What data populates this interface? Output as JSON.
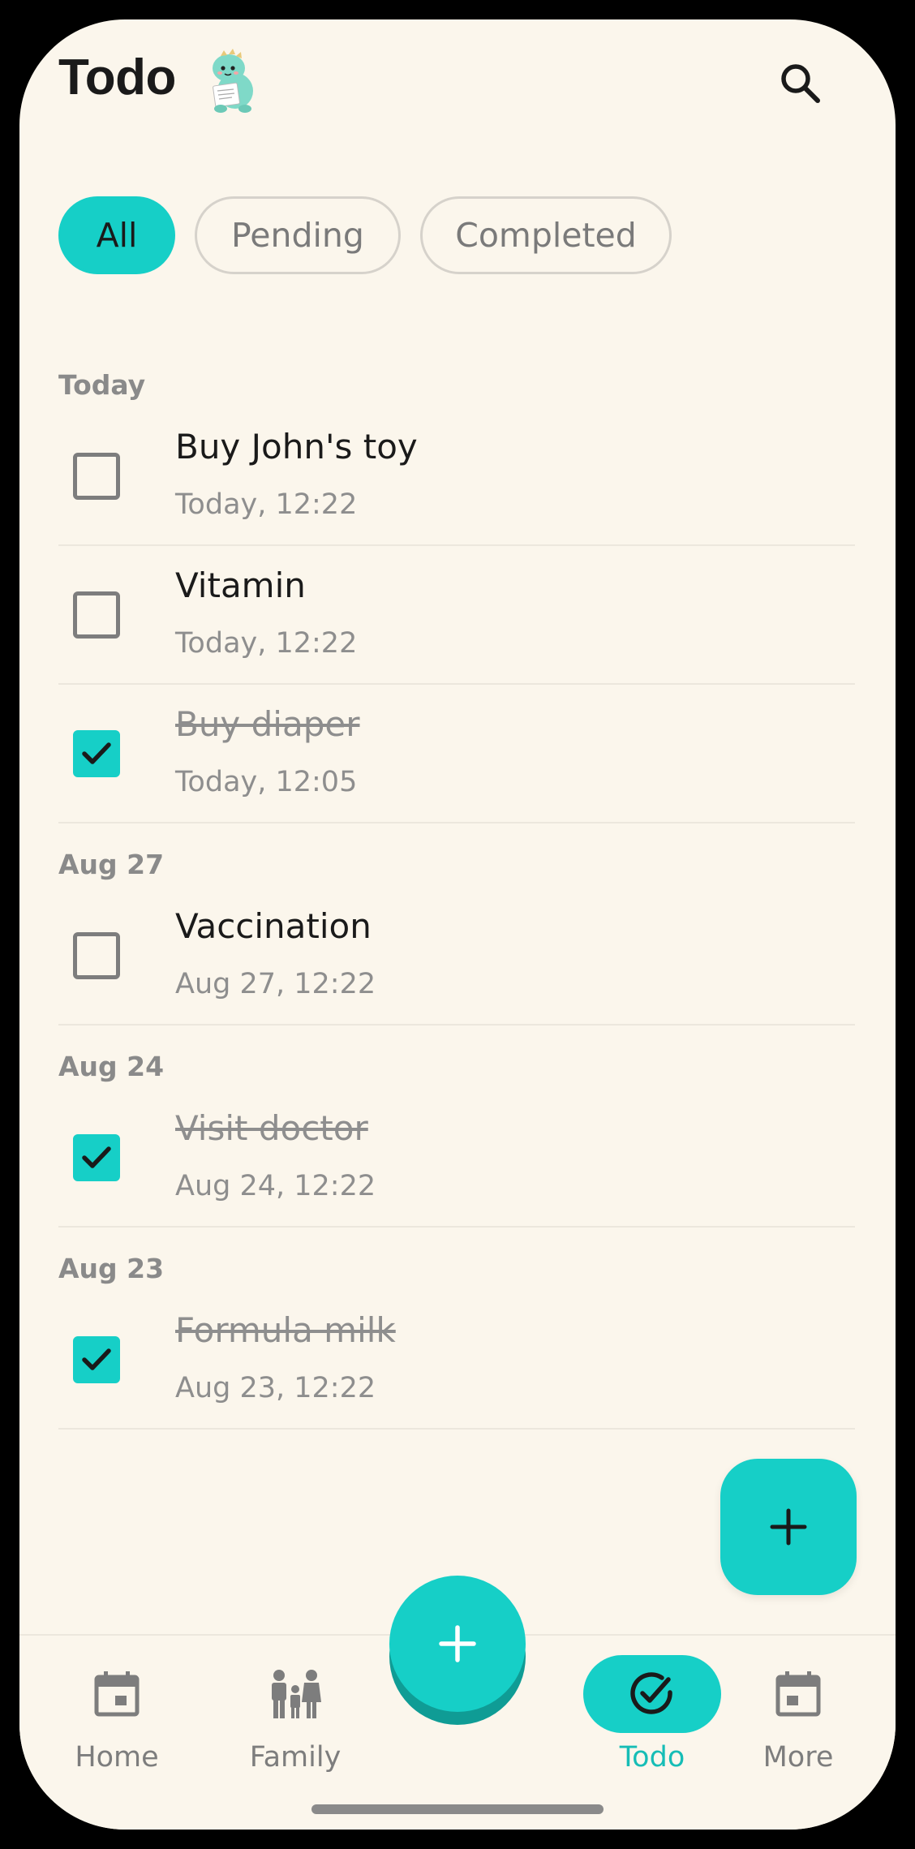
{
  "header": {
    "title": "Todo"
  },
  "filters": {
    "all": "All",
    "pending": "Pending",
    "completed": "Completed",
    "selected": "All"
  },
  "sections": [
    {
      "label": "Today",
      "items": [
        {
          "title": "Buy John's toy",
          "time": "Today, 12:22",
          "done": false
        },
        {
          "title": "Vitamin",
          "time": "Today, 12:22",
          "done": false
        },
        {
          "title": "Buy diaper",
          "time": "Today, 12:05",
          "done": true
        }
      ]
    },
    {
      "label": "Aug 27",
      "items": [
        {
          "title": "Vaccination",
          "time": "Aug 27, 12:22",
          "done": false
        }
      ]
    },
    {
      "label": "Aug 24",
      "items": [
        {
          "title": "Visit doctor",
          "time": "Aug 24, 12:22",
          "done": true
        }
      ]
    },
    {
      "label": "Aug 23",
      "items": [
        {
          "title": "Formula milk",
          "time": "Aug 23, 12:22",
          "done": true
        }
      ]
    }
  ],
  "nav": {
    "home": "Home",
    "family": "Family",
    "todo": "Todo",
    "more": "More",
    "active": "Todo"
  },
  "colors": {
    "accent": "#16cfc7",
    "accent_dark": "#0f9c95",
    "background": "#fbf6ec",
    "muted_text": "#8e8e8e"
  },
  "icons": {
    "search": "search-icon",
    "add": "plus-icon",
    "home": "calendar-icon",
    "family": "family-icon",
    "todo": "check-circle-icon",
    "more": "calendar-icon",
    "mascot": "dinosaur-mascot-icon"
  }
}
